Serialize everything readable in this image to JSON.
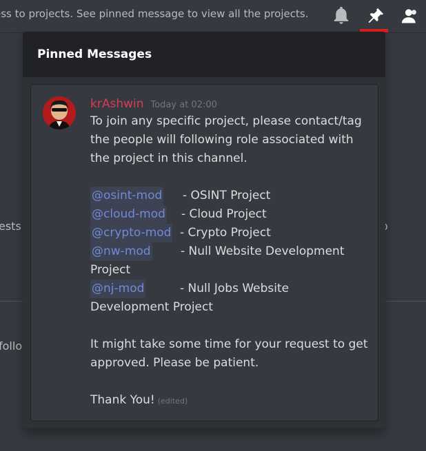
{
  "header": {
    "topic": "ess to projects. See pinned message to view all the projects.",
    "icons": {
      "bell": "bell-icon",
      "pin": "pin-icon",
      "members": "members-icon"
    },
    "active_indicator_color": "#e01e1e"
  },
  "background": {
    "snippet_left_1": "ests",
    "snippet_left_2": "follo",
    "snippet_right_1": "o"
  },
  "popout": {
    "title": "Pinned Messages",
    "message": {
      "author": "krAshwin",
      "author_color": "#d83c5a",
      "timestamp": "Today at 02:00",
      "intro_lines": [
        "To join any specific project, please contact/tag",
        "the people will following role associated with",
        "the project in this channel."
      ],
      "roles": [
        {
          "mention": "@osint-mod",
          "desc": "- OSINT Project"
        },
        {
          "mention": "@cloud-mod",
          "desc": "- Cloud Project"
        },
        {
          "mention": "@crypto-mod",
          "desc": "- Crypto Project"
        },
        {
          "mention": "@nw-mod",
          "desc": "- Null Website Development",
          "cont": "Project"
        },
        {
          "mention": "@nj-mod",
          "desc": "- Null Jobs Website",
          "cont": "Development Project"
        }
      ],
      "outro_lines": [
        "It might take some time for your request to get",
        "approved. Please be patient."
      ],
      "closing": "Thank You!",
      "edited_label": "(edited)"
    }
  }
}
